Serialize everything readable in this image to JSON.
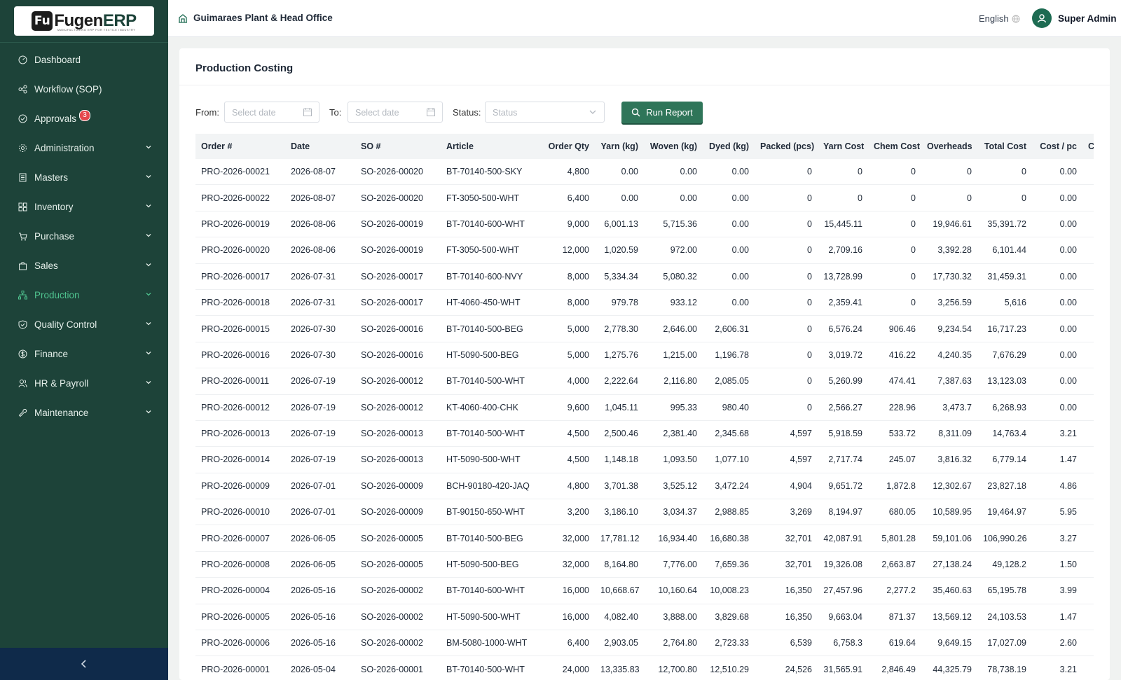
{
  "brand": {
    "logo_mark": "Fu",
    "name_a": "Fugen",
    "name_b": "ERP",
    "tagline": "MANUFACTURING ERP FOR TEXTILE INDUSTRY"
  },
  "sidebar": {
    "items": [
      {
        "label": "Dashboard",
        "icon": "dashboard-icon",
        "chevron": false
      },
      {
        "label": "Workflow (SOP)",
        "icon": "workflow-icon",
        "chevron": false
      },
      {
        "label": "Approvals",
        "icon": "check-circle-icon",
        "chevron": false,
        "badge": "3"
      },
      {
        "label": "Administration",
        "icon": "gear-icon",
        "chevron": true
      },
      {
        "label": "Masters",
        "icon": "book-icon",
        "chevron": true
      },
      {
        "label": "Inventory",
        "icon": "grid-icon",
        "chevron": true
      },
      {
        "label": "Purchase",
        "icon": "cart-icon",
        "chevron": true
      },
      {
        "label": "Sales",
        "icon": "bag-icon",
        "chevron": true
      },
      {
        "label": "Production",
        "icon": "hierarchy-icon",
        "chevron": true,
        "active": true
      },
      {
        "label": "Quality Control",
        "icon": "shield-icon",
        "chevron": true
      },
      {
        "label": "Finance",
        "icon": "dollar-icon",
        "chevron": true
      },
      {
        "label": "HR & Payroll",
        "icon": "users-icon",
        "chevron": true
      },
      {
        "label": "Maintenance",
        "icon": "wrench-icon",
        "chevron": true
      }
    ],
    "collapse_glyph": "‹"
  },
  "header": {
    "plant": "Guimaraes Plant & Head Office",
    "language": "English",
    "user": "Super Admin"
  },
  "page": {
    "title": "Production Costing"
  },
  "filters": {
    "from_label": "From",
    "from_placeholder": "Select date",
    "to_label": "To",
    "to_placeholder": "Select date",
    "status_label": "Status",
    "status_placeholder": "Status",
    "run_label": "Run Report"
  },
  "colors": {
    "sidebar": "#1d4339",
    "accent": "#2f7559",
    "active": "#4fc38f",
    "badge": "#e5484d"
  },
  "table": {
    "columns": [
      "Order #",
      "Date",
      "SO #",
      "Article",
      "Order Qty",
      "Yarn (kg)",
      "Woven (kg)",
      "Dyed (kg)",
      "Packed (pcs)",
      "Yarn Cost",
      "Chem Cost",
      "Overheads",
      "Total Cost",
      "Cost / pc",
      "C"
    ],
    "rows": [
      [
        "PRO-2026-00021",
        "2026-08-07",
        "SO-2026-00020",
        "BT-70140-500-SKY",
        "4,800",
        "0.00",
        "0.00",
        "0.00",
        "0",
        "0",
        "0",
        "0",
        "0",
        "0.00"
      ],
      [
        "PRO-2026-00022",
        "2026-08-07",
        "SO-2026-00020",
        "FT-3050-500-WHT",
        "6,400",
        "0.00",
        "0.00",
        "0.00",
        "0",
        "0",
        "0",
        "0",
        "0",
        "0.00"
      ],
      [
        "PRO-2026-00019",
        "2026-08-06",
        "SO-2026-00019",
        "BT-70140-600-WHT",
        "9,000",
        "6,001.13",
        "5,715.36",
        "0.00",
        "0",
        "15,445.11",
        "0",
        "19,946.61",
        "35,391.72",
        "0.00"
      ],
      [
        "PRO-2026-00020",
        "2026-08-06",
        "SO-2026-00019",
        "FT-3050-500-WHT",
        "12,000",
        "1,020.59",
        "972.00",
        "0.00",
        "0",
        "2,709.16",
        "0",
        "3,392.28",
        "6,101.44",
        "0.00"
      ],
      [
        "PRO-2026-00017",
        "2026-07-31",
        "SO-2026-00017",
        "BT-70140-600-NVY",
        "8,000",
        "5,334.34",
        "5,080.32",
        "0.00",
        "0",
        "13,728.99",
        "0",
        "17,730.32",
        "31,459.31",
        "0.00"
      ],
      [
        "PRO-2026-00018",
        "2026-07-31",
        "SO-2026-00017",
        "HT-4060-450-WHT",
        "8,000",
        "979.78",
        "933.12",
        "0.00",
        "0",
        "2,359.41",
        "0",
        "3,256.59",
        "5,616",
        "0.00"
      ],
      [
        "PRO-2026-00015",
        "2026-07-30",
        "SO-2026-00016",
        "BT-70140-500-BEG",
        "5,000",
        "2,778.30",
        "2,646.00",
        "2,606.31",
        "0",
        "6,576.24",
        "906.46",
        "9,234.54",
        "16,717.23",
        "0.00"
      ],
      [
        "PRO-2026-00016",
        "2026-07-30",
        "SO-2026-00016",
        "HT-5090-500-BEG",
        "5,000",
        "1,275.76",
        "1,215.00",
        "1,196.78",
        "0",
        "3,019.72",
        "416.22",
        "4,240.35",
        "7,676.29",
        "0.00"
      ],
      [
        "PRO-2026-00011",
        "2026-07-19",
        "SO-2026-00012",
        "BT-70140-500-WHT",
        "4,000",
        "2,222.64",
        "2,116.80",
        "2,085.05",
        "0",
        "5,260.99",
        "474.41",
        "7,387.63",
        "13,123.03",
        "0.00"
      ],
      [
        "PRO-2026-00012",
        "2026-07-19",
        "SO-2026-00012",
        "KT-4060-400-CHK",
        "9,600",
        "1,045.11",
        "995.33",
        "980.40",
        "0",
        "2,566.27",
        "228.96",
        "3,473.7",
        "6,268.93",
        "0.00"
      ],
      [
        "PRO-2026-00013",
        "2026-07-19",
        "SO-2026-00013",
        "BT-70140-500-WHT",
        "4,500",
        "2,500.46",
        "2,381.40",
        "2,345.68",
        "4,597",
        "5,918.59",
        "533.72",
        "8,311.09",
        "14,763.4",
        "3.21"
      ],
      [
        "PRO-2026-00014",
        "2026-07-19",
        "SO-2026-00013",
        "HT-5090-500-WHT",
        "4,500",
        "1,148.18",
        "1,093.50",
        "1,077.10",
        "4,597",
        "2,717.74",
        "245.07",
        "3,816.32",
        "6,779.14",
        "1.47"
      ],
      [
        "PRO-2026-00009",
        "2026-07-01",
        "SO-2026-00009",
        "BCH-90180-420-JAQ",
        "4,800",
        "3,701.38",
        "3,525.12",
        "3,472.24",
        "4,904",
        "9,651.72",
        "1,872.8",
        "12,302.67",
        "23,827.18",
        "4.86"
      ],
      [
        "PRO-2026-00010",
        "2026-07-01",
        "SO-2026-00009",
        "BT-90150-650-WHT",
        "3,200",
        "3,186.10",
        "3,034.37",
        "2,988.85",
        "3,269",
        "8,194.97",
        "680.05",
        "10,589.95",
        "19,464.97",
        "5.95"
      ],
      [
        "PRO-2026-00007",
        "2026-06-05",
        "SO-2026-00005",
        "BT-70140-500-BEG",
        "32,000",
        "17,781.12",
        "16,934.40",
        "16,680.38",
        "32,701",
        "42,087.91",
        "5,801.28",
        "59,101.06",
        "106,990.26",
        "3.27"
      ],
      [
        "PRO-2026-00008",
        "2026-06-05",
        "SO-2026-00005",
        "HT-5090-500-BEG",
        "32,000",
        "8,164.80",
        "7,776.00",
        "7,659.36",
        "32,701",
        "19,326.08",
        "2,663.87",
        "27,138.24",
        "49,128.2",
        "1.50"
      ],
      [
        "PRO-2026-00004",
        "2026-05-16",
        "SO-2026-00002",
        "BT-70140-600-WHT",
        "16,000",
        "10,668.67",
        "10,160.64",
        "10,008.23",
        "16,350",
        "27,457.96",
        "2,277.2",
        "35,460.63",
        "65,195.78",
        "3.99"
      ],
      [
        "PRO-2026-00005",
        "2026-05-16",
        "SO-2026-00002",
        "HT-5090-500-WHT",
        "16,000",
        "4,082.40",
        "3,888.00",
        "3,829.68",
        "16,350",
        "9,663.04",
        "871.37",
        "13,569.12",
        "24,103.53",
        "1.47"
      ],
      [
        "PRO-2026-00006",
        "2026-05-16",
        "SO-2026-00002",
        "BM-5080-1000-WHT",
        "6,400",
        "2,903.05",
        "2,764.80",
        "2,723.33",
        "6,539",
        "6,758.3",
        "619.64",
        "9,649.15",
        "17,027.09",
        "2.60"
      ],
      [
        "PRO-2026-00001",
        "2026-05-04",
        "SO-2026-00001",
        "BT-70140-500-WHT",
        "24,000",
        "13,335.83",
        "12,700.80",
        "12,510.29",
        "24,526",
        "31,565.91",
        "2,846.49",
        "44,325.79",
        "78,738.19",
        "3.21"
      ]
    ]
  }
}
